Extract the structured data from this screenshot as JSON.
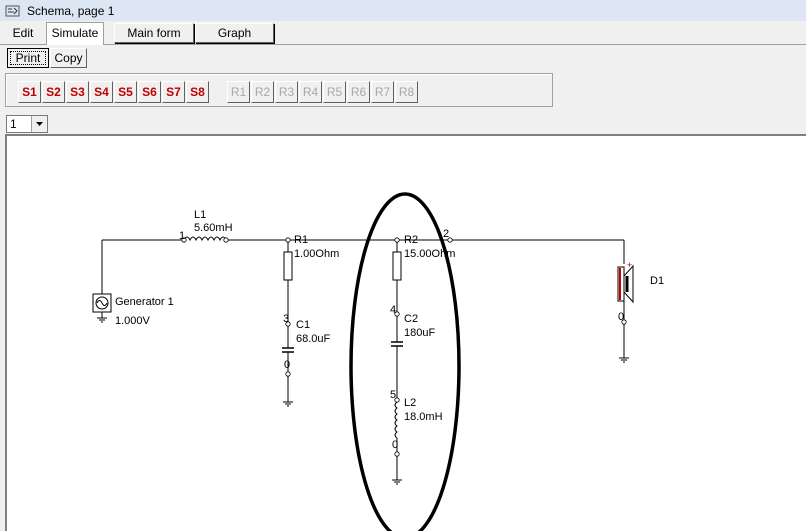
{
  "window": {
    "title": "Schema, page 1"
  },
  "menu": {
    "tabs": [
      "Edit",
      "Simulate"
    ],
    "buttons": [
      "Main form",
      "Graph"
    ]
  },
  "toolbar": {
    "print_label": "Print",
    "copy_label": "Copy"
  },
  "scenario_buttons": {
    "s": [
      "S1",
      "S2",
      "S3",
      "S4",
      "S5",
      "S6",
      "S7",
      "S8"
    ],
    "r": [
      "R1",
      "R2",
      "R3",
      "R4",
      "R5",
      "R6",
      "R7",
      "R8"
    ]
  },
  "page_select": {
    "value": "1"
  },
  "schematic": {
    "l1": {
      "name": "L1",
      "value": "5.60mH"
    },
    "r1": {
      "name": "R1",
      "value": "1.00Ohm"
    },
    "r2": {
      "name": "R2",
      "value": "15.00Ohm"
    },
    "c1": {
      "name": "C1",
      "value": "68.0uF"
    },
    "c2": {
      "name": "C2",
      "value": "180uF"
    },
    "l2": {
      "name": "L2",
      "value": "18.0mH"
    },
    "generator": {
      "name": "Generator 1",
      "value": "1.000V"
    },
    "speaker": {
      "name": "D1"
    },
    "nodes": {
      "n1": "1",
      "n2": "2",
      "n3": "3",
      "n4": "4",
      "n5": "5",
      "n0a": "0",
      "n0b": "0",
      "n0c": "0"
    }
  },
  "colors": {
    "speaker_accent": "#c00000",
    "s_text": "#c00000",
    "r_text": "#a8a8a8"
  }
}
